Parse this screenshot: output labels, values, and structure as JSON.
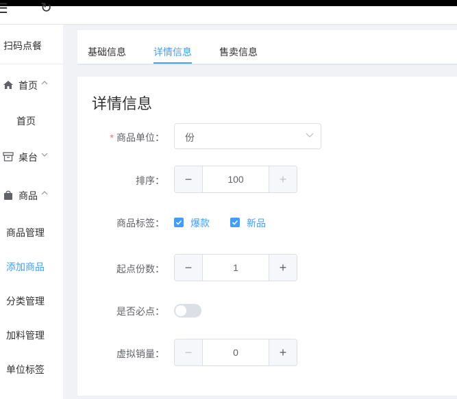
{
  "topbar": {
    "menu_icon": "☰",
    "refresh_icon": "↻"
  },
  "sidebar": {
    "title": "扫码点餐",
    "groups": [
      {
        "label": "首页",
        "icon": "home-icon",
        "chevron": "^"
      },
      {
        "label": "桌台",
        "icon": "table-icon",
        "chevron": "v"
      },
      {
        "label": "商品",
        "icon": "bag-icon",
        "chevron": "^"
      }
    ],
    "items": {
      "home": "首页",
      "product_manage": "商品管理",
      "add_product": "添加商品",
      "category_manage": "分类管理",
      "addon_manage": "加料管理",
      "unit_tag": "单位标签"
    }
  },
  "tabs": [
    "基础信息",
    "详情信息",
    "售卖信息"
  ],
  "active_tab": "详情信息",
  "section_title": "详情信息",
  "form": {
    "unit": {
      "label": "商品单位：",
      "value": "份",
      "required": "*"
    },
    "sort": {
      "label": "排序：",
      "value": "100",
      "dec": "−",
      "inc": "+"
    },
    "tags": {
      "label": "商品标签：",
      "options": [
        "爆款",
        "新品"
      ]
    },
    "min_qty": {
      "label": "起点份数：",
      "value": "1",
      "dec": "−",
      "inc": "+"
    },
    "required_order": {
      "label": "是否必点：",
      "on": false
    },
    "virtual_sales": {
      "label": "虚拟销量：",
      "value": "0",
      "dec": "−",
      "inc": "+"
    }
  },
  "colors": {
    "accent": "#409eff",
    "required": "#f56c6c"
  }
}
